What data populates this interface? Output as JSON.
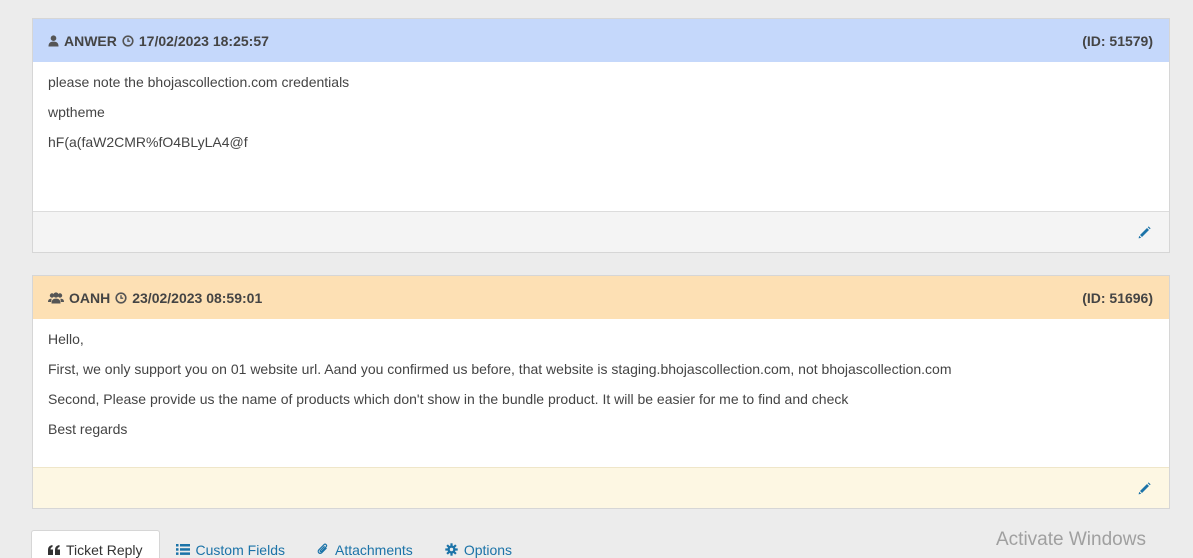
{
  "replies": [
    {
      "author": "ANWER",
      "author_icon": "user-icon",
      "datetime": "17/02/2023 18:25:57",
      "id": "(ID: 51579)",
      "lines": [
        "please note the bhojascollection.com credentials",
        "wptheme",
        "hF(a(faW2CMR%fO4BLyLA4@f"
      ],
      "header_color": "#c5d8fb"
    },
    {
      "author": "OANH",
      "author_icon": "users-icon",
      "datetime": "23/02/2023 08:59:01",
      "id": "(ID: 51696)",
      "lines": [
        "Hello,",
        "First, we only support you on 01 website url. Aand you confirmed us before, that website is staging.bhojascollection.com, not bhojascollection.com",
        "Second, Please provide us the name of products which don't show in the bundle product. It will be easier for me to find and check",
        "Best regards"
      ],
      "header_color": "#fde0b4"
    }
  ],
  "tabs": [
    {
      "label": "Ticket Reply",
      "icon": "quote-icon",
      "active": true
    },
    {
      "label": "Custom Fields",
      "icon": "list-icon",
      "active": false
    },
    {
      "label": "Attachments",
      "icon": "paperclip-icon",
      "active": false
    },
    {
      "label": "Options",
      "icon": "gear-icon",
      "active": false
    }
  ],
  "watermark": "Activate Windows",
  "colors": {
    "link": "#1b73a8",
    "edit_icon": "#1b73a8"
  }
}
